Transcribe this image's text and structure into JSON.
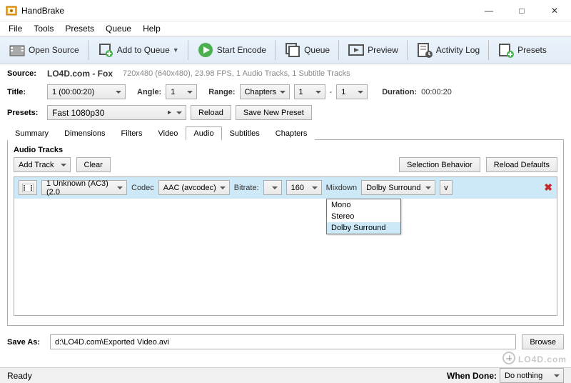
{
  "window": {
    "title": "HandBrake",
    "controls": {
      "minimize": "—",
      "maximize": "□",
      "close": "✕"
    }
  },
  "menubar": [
    "File",
    "Tools",
    "Presets",
    "Queue",
    "Help"
  ],
  "toolbar": {
    "open_source": "Open Source",
    "add_to_queue": "Add to Queue",
    "start_encode": "Start Encode",
    "queue": "Queue",
    "preview": "Preview",
    "activity_log": "Activity Log",
    "presets": "Presets"
  },
  "source": {
    "label": "Source:",
    "name": "LO4D.com - Fox",
    "info": "720x480 (640x480), 23.98 FPS, 1 Audio Tracks, 1 Subtitle Tracks"
  },
  "title_row": {
    "title_label": "Title:",
    "title_value": "1 (00:00:20)",
    "angle_label": "Angle:",
    "angle_value": "1",
    "range_label": "Range:",
    "range_type": "Chapters",
    "range_from": "1",
    "range_sep": "-",
    "range_to": "1",
    "duration_label": "Duration:",
    "duration_value": "00:00:20"
  },
  "presets_row": {
    "label": "Presets:",
    "value": "Fast 1080p30",
    "reload": "Reload",
    "save_new": "Save New Preset"
  },
  "tabs": [
    "Summary",
    "Dimensions",
    "Filters",
    "Video",
    "Audio",
    "Subtitles",
    "Chapters"
  ],
  "active_tab": "Audio",
  "audio": {
    "section_title": "Audio Tracks",
    "add_track": "Add Track",
    "clear": "Clear",
    "selection_behavior": "Selection Behavior",
    "reload_defaults": "Reload Defaults",
    "track": {
      "source": "1 Unknown (AC3) (2.0",
      "codec_label": "Codec",
      "codec_value": "AAC (avcodec)",
      "bitrate_label": "Bitrate:",
      "bitrate_value": "160",
      "mixdown_label": "Mixdown",
      "mixdown_value": "Dolby Surround",
      "expand": "v"
    },
    "mixdown_options": [
      "Mono",
      "Stereo",
      "Dolby Surround"
    ],
    "mixdown_highlight": "Dolby Surround"
  },
  "save_as": {
    "label": "Save As:",
    "path": "d:\\LO4D.com\\Exported Video.avi",
    "browse": "Browse"
  },
  "statusbar": {
    "ready": "Ready",
    "when_done_label": "When Done:",
    "when_done_value": "Do nothing"
  },
  "watermark": "LO4D.com"
}
